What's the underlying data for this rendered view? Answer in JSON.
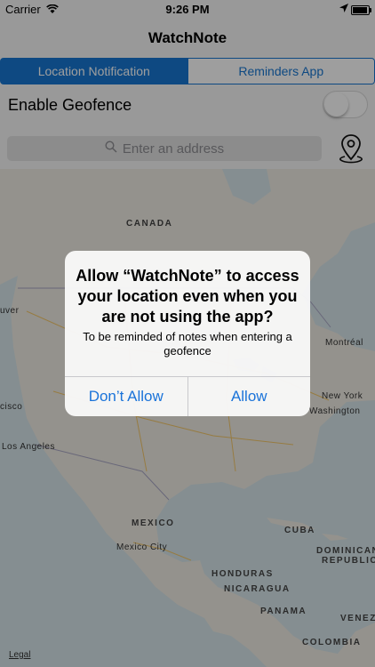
{
  "status_bar": {
    "carrier": "Carrier",
    "time": "9:26 PM",
    "battery_level": 0.95
  },
  "nav": {
    "title": "WatchNote"
  },
  "segmented": {
    "options": [
      "Location Notification",
      "Reminders App"
    ],
    "selected": "Location Notification"
  },
  "geofence": {
    "label": "Enable Geofence",
    "enabled": false
  },
  "search": {
    "placeholder": "Enter an address"
  },
  "map": {
    "labels": {
      "canada": "CANADA",
      "couver": "uver",
      "montreal": "Montréal",
      "new_york": "New York",
      "washington": "Washington",
      "cisco": "cisco",
      "los_angeles": "Los Angeles",
      "mexico": "MEXICO",
      "mexico_city": "Mexico City",
      "cuba": "CUBA",
      "dominican": "DOMINICAN",
      "republic": "REPUBLIC",
      "honduras": "HONDURAS",
      "nicaragua": "NICARAGUA",
      "panama": "PANAMA",
      "venez": "VENEZ",
      "colombia": "COLOMBIA"
    },
    "legal": "Legal"
  },
  "alert": {
    "title": "Allow “WatchNote” to access your location even when you are not using the app?",
    "message": "To be reminded of notes when entering a geofence",
    "buttons": {
      "deny": "Don’t Allow",
      "allow": "Allow"
    }
  },
  "colors": {
    "accent": "#1877d2",
    "alert_button": "#1a73d9",
    "water": "#d7e6ea",
    "land": "#efece4"
  }
}
